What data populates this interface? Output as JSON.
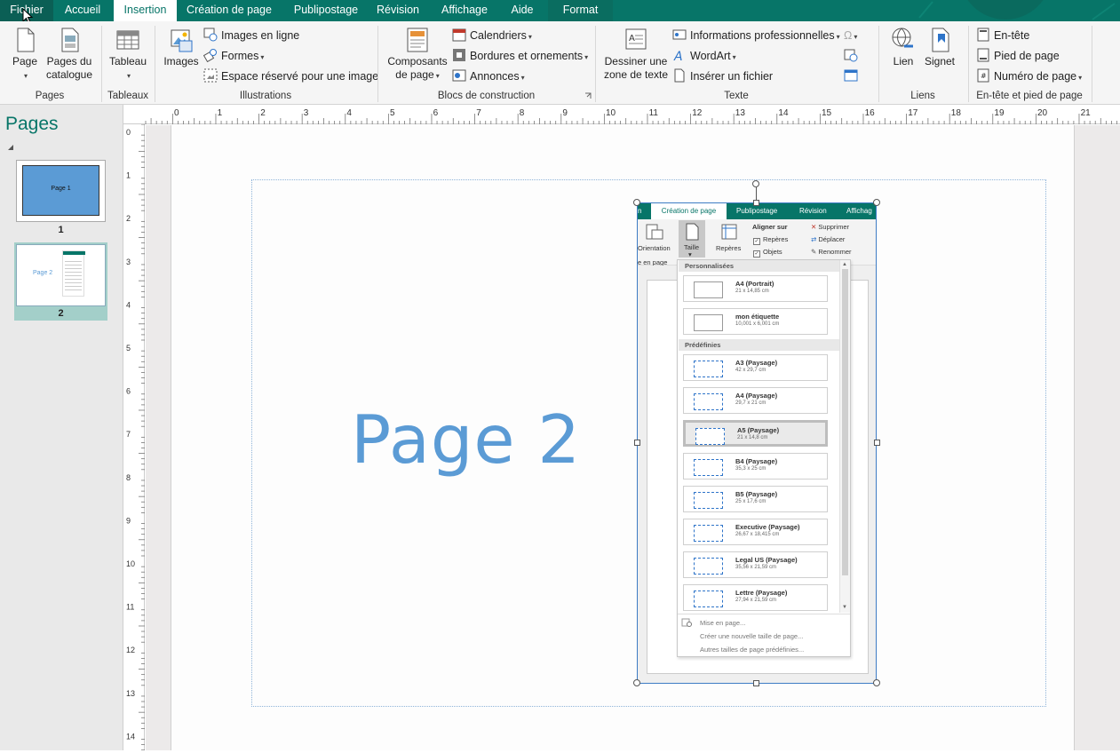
{
  "menu": {
    "tabs": [
      "Fichier",
      "Accueil",
      "Insertion",
      "Création de page",
      "Publipostage",
      "Révision",
      "Affichage",
      "Aide",
      "Format"
    ],
    "active_tab": "Insertion"
  },
  "ribbon": {
    "pages": {
      "label": "Pages",
      "page": "Page",
      "catalogue": "Pages du catalogue"
    },
    "tableaux": {
      "label": "Tableaux",
      "tableau": "Tableau"
    },
    "illustrations": {
      "label": "Illustrations",
      "images": "Images",
      "images_en_ligne": "Images en ligne",
      "formes": "Formes",
      "espace": "Espace réservé pour une image"
    },
    "blocs": {
      "label": "Blocs de construction",
      "composants": "Composants de page",
      "calendriers": "Calendriers",
      "bordures": "Bordures et ornements",
      "annonces": "Annonces"
    },
    "texte": {
      "label": "Texte",
      "dessiner": "Dessiner une zone de texte",
      "infos": "Informations professionnelles",
      "wordart": "WordArt",
      "inserer_fichier": "Insérer un fichier",
      "omega": "Ω"
    },
    "liens": {
      "label": "Liens",
      "lien": "Lien",
      "signet": "Signet"
    },
    "entete": {
      "label": "En-tête et pied de page",
      "en_tete": "En-tête",
      "pied": "Pied de page",
      "numero": "Numéro de page"
    }
  },
  "pages_pane": {
    "title": "Pages",
    "thumbs": [
      {
        "num": "1",
        "label": "Page 1"
      },
      {
        "num": "2",
        "label": "Page 2"
      }
    ]
  },
  "ruler": {
    "h": [
      "0",
      "1",
      "2",
      "3",
      "4",
      "5",
      "6",
      "7",
      "8",
      "9",
      "10",
      "11",
      "12",
      "13",
      "14",
      "15",
      "16",
      "17",
      "18",
      "19",
      "20",
      "21"
    ],
    "v": [
      "0",
      "1",
      "2",
      "3",
      "4",
      "5",
      "6",
      "7",
      "8",
      "9",
      "10",
      "11",
      "12",
      "13",
      "14"
    ]
  },
  "canvas": {
    "big_text": "Page 2"
  },
  "screenshot": {
    "tabs": [
      "n",
      "Création de page",
      "Publipostage",
      "Révision",
      "Affichag"
    ],
    "orientation": "Orientation",
    "taille": "Taille",
    "reperes": "Repères",
    "aligner_sur": "Aligner sur",
    "aligner_reperes": "Repères",
    "aligner_objets": "Objets",
    "supprimer": "Supprimer",
    "deplacer": "Déplacer",
    "renommer": "Renommer",
    "mise_en_page_label": "e en page",
    "dropdown": {
      "section_custom": "Personnalisées",
      "section_predef": "Prédéfinies",
      "custom_items": [
        {
          "name": "A4 (Portrait)",
          "dim": "21 x 14,85 cm"
        },
        {
          "name": "mon étiquette",
          "dim": "10,001 x 6,001 cm"
        }
      ],
      "predef_items": [
        {
          "name": "A3 (Paysage)",
          "dim": "42 x 29,7 cm"
        },
        {
          "name": "A4 (Paysage)",
          "dim": "29,7 x 21 cm"
        },
        {
          "name": "A5 (Paysage)",
          "dim": "21 x 14,8 cm"
        },
        {
          "name": "B4 (Paysage)",
          "dim": "35,3 x 25 cm"
        },
        {
          "name": "B5 (Paysage)",
          "dim": "25 x 17,6 cm"
        },
        {
          "name": "Executive (Paysage)",
          "dim": "26,67 x 18,415 cm"
        },
        {
          "name": "Legal US (Paysage)",
          "dim": "35,56 x 21,59 cm"
        },
        {
          "name": "Lettre (Paysage)",
          "dim": "27,94 x 21,59 cm"
        }
      ],
      "selected": "A5 (Paysage)",
      "footer": [
        "Mise en page...",
        "Créer une nouvelle taille de page...",
        "Autres tailles de page prédéfinies..."
      ]
    }
  },
  "colors": {
    "accent": "#077568",
    "page_text": "#5b9bd5",
    "selection": "#3e7cc4"
  }
}
